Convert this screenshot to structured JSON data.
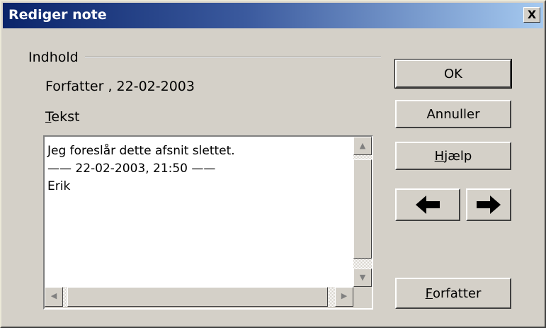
{
  "window": {
    "title": "Rediger note",
    "close_label": "X"
  },
  "content": {
    "group_label": "Indhold",
    "author_line": "Forfatter , 22-02-2003",
    "tekst_label": {
      "mnemonic": "T",
      "rest": "ekst"
    },
    "text_lines": [
      "Jeg foreslår dette afsnit slettet.",
      "—— 22-02-2003, 21:50 ——",
      "Erik"
    ]
  },
  "buttons": {
    "ok": "OK",
    "cancel": "Annuller",
    "help": {
      "mnemonic": "H",
      "rest": "jælp"
    },
    "prev_icon": "arrow-left-icon",
    "next_icon": "arrow-right-icon",
    "author": {
      "mnemonic": "F",
      "rest": "orfatter"
    }
  }
}
